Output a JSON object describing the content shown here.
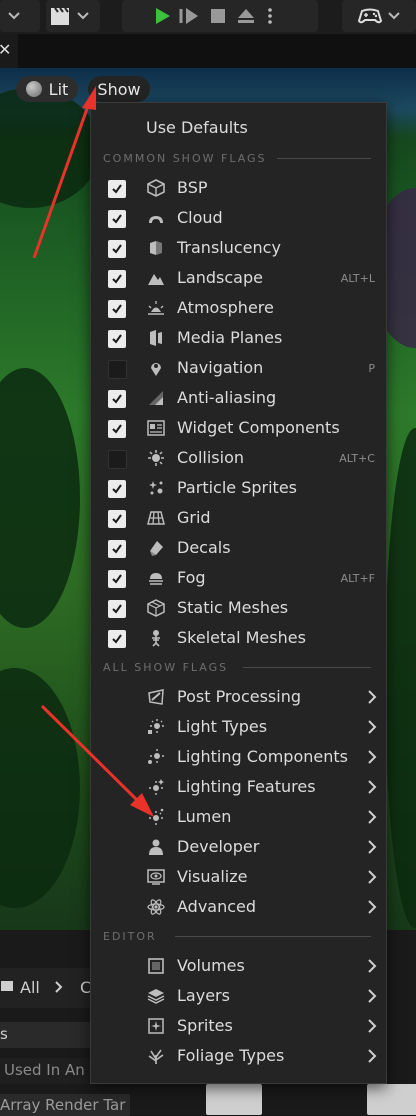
{
  "viewport": {
    "lit_label": "Lit",
    "show_label": "Show"
  },
  "menu": {
    "use_defaults": "Use Defaults",
    "sections": {
      "common": "COMMON SHOW FLAGS",
      "all": "ALL SHOW FLAGS",
      "editor": "EDITOR"
    },
    "common_flags": [
      {
        "label": "BSP",
        "checked": true,
        "shortcut": "",
        "icon": "cube-icon"
      },
      {
        "label": "Cloud",
        "checked": true,
        "shortcut": "",
        "icon": "cloud-icon"
      },
      {
        "label": "Translucency",
        "checked": true,
        "shortcut": "",
        "icon": "translucency-icon"
      },
      {
        "label": "Landscape",
        "checked": true,
        "shortcut": "ALT+L",
        "icon": "mountain-icon"
      },
      {
        "label": "Atmosphere",
        "checked": true,
        "shortcut": "",
        "icon": "sunrise-icon"
      },
      {
        "label": "Media Planes",
        "checked": true,
        "shortcut": "",
        "icon": "media-plane-icon"
      },
      {
        "label": "Navigation",
        "checked": false,
        "shortcut": "P",
        "icon": "map-pin-icon"
      },
      {
        "label": "Anti-aliasing",
        "checked": true,
        "shortcut": "",
        "icon": "staircase-icon"
      },
      {
        "label": "Widget Components",
        "checked": true,
        "shortcut": "",
        "icon": "widget-icon"
      },
      {
        "label": "Collision",
        "checked": false,
        "shortcut": "ALT+C",
        "icon": "collision-icon"
      },
      {
        "label": "Particle Sprites",
        "checked": true,
        "shortcut": "",
        "icon": "particles-icon"
      },
      {
        "label": "Grid",
        "checked": true,
        "shortcut": "",
        "icon": "grid-icon"
      },
      {
        "label": "Decals",
        "checked": true,
        "shortcut": "",
        "icon": "decal-icon"
      },
      {
        "label": "Fog",
        "checked": true,
        "shortcut": "ALT+F",
        "icon": "fog-icon"
      },
      {
        "label": "Static Meshes",
        "checked": true,
        "shortcut": "",
        "icon": "static-mesh-icon"
      },
      {
        "label": "Skeletal Meshes",
        "checked": true,
        "shortcut": "",
        "icon": "skeleton-icon"
      }
    ],
    "all_flags": [
      {
        "label": "Post Processing",
        "icon": "post-process-icon"
      },
      {
        "label": "Light Types",
        "icon": "light-types-icon"
      },
      {
        "label": "Lighting Components",
        "icon": "lighting-components-icon"
      },
      {
        "label": "Lighting Features",
        "icon": "lighting-features-icon"
      },
      {
        "label": "Lumen",
        "icon": "lumen-icon"
      },
      {
        "label": "Developer",
        "icon": "person-icon"
      },
      {
        "label": "Visualize",
        "icon": "visualize-icon"
      },
      {
        "label": "Advanced",
        "icon": "atom-icon"
      }
    ],
    "editor_flags": [
      {
        "label": "Volumes",
        "icon": "volume-icon"
      },
      {
        "label": "Layers",
        "icon": "layers-icon"
      },
      {
        "label": "Sprites",
        "icon": "sprite-icon"
      },
      {
        "label": "Foliage Types",
        "icon": "foliage-icon"
      }
    ]
  },
  "content_browser": {
    "breadcrumb_all": "All",
    "breadcrumb_next": "C",
    "col_header": "s",
    "row1": "Used In An",
    "row2": "Array Render Tar"
  },
  "colors": {
    "menu_bg": "#242424",
    "accent_green": "#3cc040",
    "annotation_red": "#e8322a"
  }
}
